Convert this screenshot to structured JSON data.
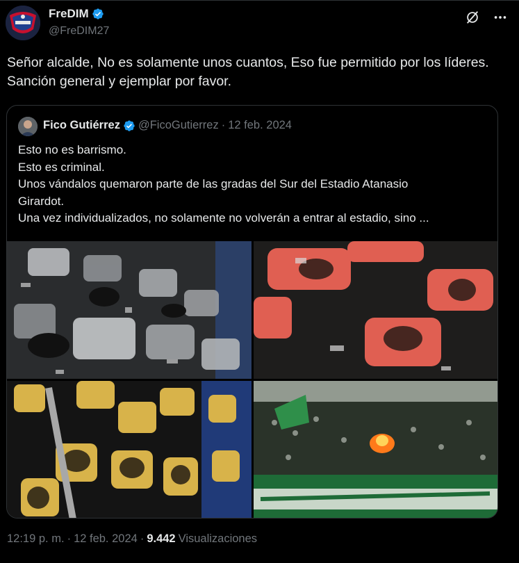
{
  "author": {
    "display_name": "FreDIM",
    "handle": "@FreDIM27",
    "verified": true,
    "avatar_icon": "team-shield-avatar"
  },
  "actions": {
    "grok_icon": "grok-slash-icon",
    "more_icon": "more-dots-icon"
  },
  "tweet": {
    "text": "Señor alcalde, No es solamente unos cuantos, Eso fue permitido por los líderes. Sanción general y ejemplar por favor."
  },
  "quote": {
    "display_name": "Fico Gutiérrez",
    "handle": "@FicoGutierrez",
    "separator": "·",
    "date": "12 feb. 2024",
    "verified": true,
    "lines": [
      "Esto no es barrismo.",
      "Esto es criminal.",
      "Unos vándalos quemaron parte de las gradas del Sur del Estadio Atanasio",
      "Girardot.",
      "Una vez individualizados, no solamente no volverán a entrar al estadio, sino ..."
    ]
  },
  "footer": {
    "time": "12:19 p. m.",
    "separator1": "·",
    "date": "12 feb. 2024",
    "separator2": "·",
    "views_count": "9.442",
    "views_label": "Visualizaciones"
  },
  "colors": {
    "background": "#000000",
    "text": "#e7e9ea",
    "muted": "#71767b",
    "border": "#2f3336",
    "verified": "#1d9bf0"
  }
}
